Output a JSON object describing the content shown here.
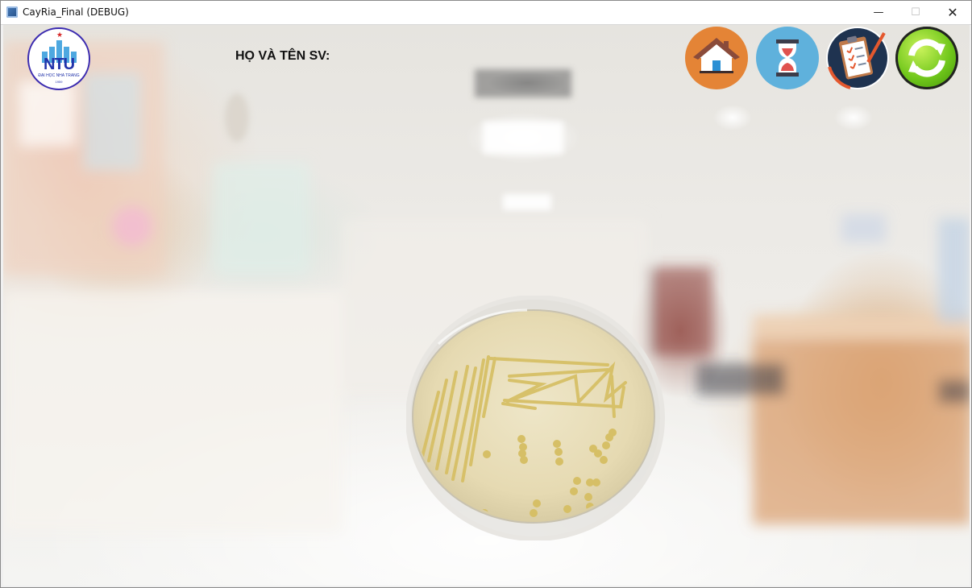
{
  "window": {
    "title": "CayRia_Final (DEBUG)",
    "controls": {
      "minimize": "—",
      "maximize": "☐",
      "close": "✕"
    }
  },
  "logo": {
    "text": "NTU",
    "subtitle": "ĐẠI HỌC NHA TRANG",
    "year": "1959"
  },
  "header": {
    "student_name_label": "HỌ VÀ TÊN SV:"
  },
  "toolbar": {
    "buttons": [
      {
        "icon": "home-icon",
        "color": "#e48436"
      },
      {
        "icon": "hourglass-icon",
        "color": "#5fb1dc"
      },
      {
        "icon": "clipboard-checklist-icon",
        "color": "#ffffff"
      },
      {
        "icon": "refresh-icon",
        "color": "#6fc61a"
      }
    ]
  },
  "scene": {
    "background": "blurred hospital laboratory corridor",
    "object": "petri dish with bacterial streak culture",
    "culture_color": "#d7c06a",
    "agar_color": "#ece2bf"
  }
}
